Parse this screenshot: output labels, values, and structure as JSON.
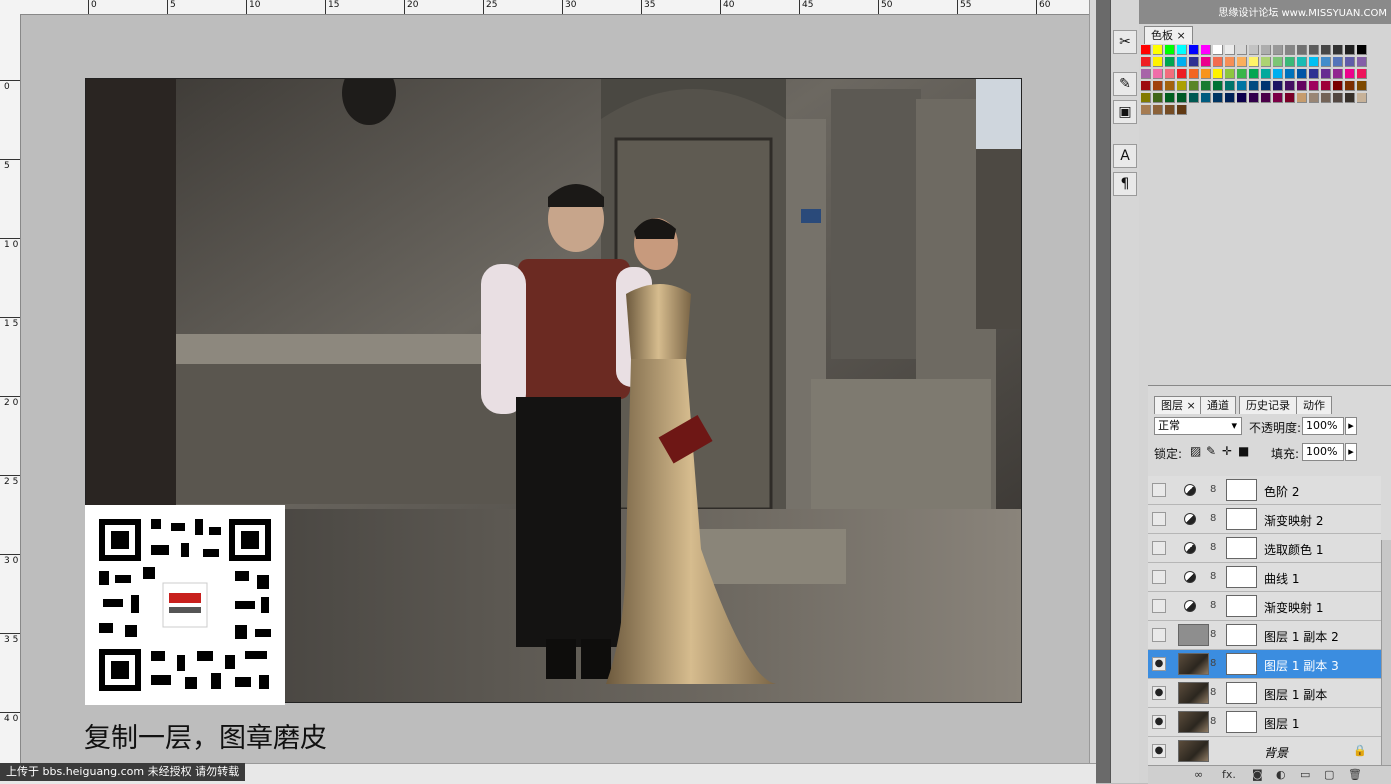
{
  "ruler_top": [
    "0",
    "5",
    "10",
    "15",
    "20",
    "25",
    "30",
    "35",
    "40",
    "45",
    "50",
    "55",
    "60"
  ],
  "ruler_left": [
    "0",
    "5",
    "1 0",
    "1 5",
    "2 0",
    "2 5",
    "3 0",
    "3 5",
    "4 0"
  ],
  "caption": "复制一层，图章磨皮",
  "watermark": "上传于 bbs.heiguang.com  未经授权  请勿转载",
  "site_label": "思缘设计论坛 www.MISSYUAN.COM",
  "swatches_tab": "色板",
  "layers_tabs": [
    "图层",
    "通道",
    "历史记录",
    "动作"
  ],
  "blend_mode": "正常",
  "opacity_label": "不透明度:",
  "opacity_value": "100%",
  "lock_label": "锁定:",
  "fill_label": "填充:",
  "fill_value": "100%",
  "layers": [
    {
      "name": "色阶 2",
      "visible": false,
      "type": "adjustment",
      "selected": false
    },
    {
      "name": "渐变映射 2",
      "visible": false,
      "type": "adjustment",
      "selected": false
    },
    {
      "name": "选取颜色 1",
      "visible": false,
      "type": "adjustment",
      "selected": false
    },
    {
      "name": "曲线 1",
      "visible": false,
      "type": "adjustment",
      "selected": false
    },
    {
      "name": "渐变映射 1",
      "visible": false,
      "type": "adjustment",
      "selected": false
    },
    {
      "name": "图层 1 副本 2",
      "visible": false,
      "type": "pixel",
      "selected": false
    },
    {
      "name": "图层 1 副本 3",
      "visible": true,
      "type": "pixel",
      "selected": true
    },
    {
      "name": "图层 1 副本",
      "visible": true,
      "type": "pixel",
      "selected": false
    },
    {
      "name": "图层 1",
      "visible": true,
      "type": "pixel",
      "selected": false
    },
    {
      "name": "背景",
      "visible": true,
      "type": "background",
      "selected": false
    }
  ],
  "icons": {
    "eye": "eye-icon",
    "lock": "lock-icon",
    "link": "link-icon",
    "adjustment": "adjustment-icon"
  },
  "colors": {
    "selected_layer": "#3b8de0",
    "canvas_bg": "#bdbdbd",
    "panel_bg": "#d4d4d4"
  }
}
